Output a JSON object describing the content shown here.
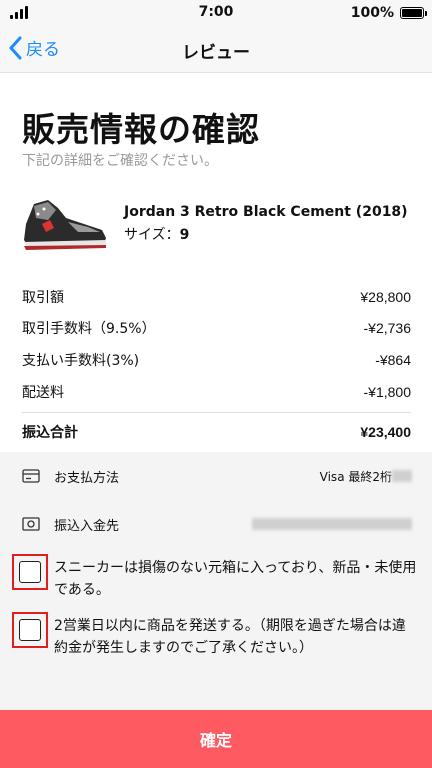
{
  "status_bar": {
    "time": "7:00",
    "battery": "100%"
  },
  "nav": {
    "back_label": "戻る",
    "title": "レビュー"
  },
  "page": {
    "title": "販売情報の確認",
    "subtitle": "下記の詳細をご確認ください。"
  },
  "product": {
    "name": "Jordan 3 Retro Black Cement (2018)",
    "size_label": "サイズ：",
    "size_value": "9"
  },
  "fees": [
    {
      "label": "取引額",
      "amount": "¥28,800"
    },
    {
      "label": "取引手数料（9.5%）",
      "amount": "-¥2,736"
    },
    {
      "label": "支払い手数料(3%)",
      "amount": "-¥864"
    },
    {
      "label": "配送料",
      "amount": "-¥1,800"
    }
  ],
  "total": {
    "label": "振込合計",
    "amount": "¥23,400"
  },
  "payment": {
    "label": "お支払方法",
    "value": "Visa 最終2桁"
  },
  "deposit": {
    "label": "振込入金先"
  },
  "checks": [
    {
      "text": "スニーカーは損傷のない元箱に入っており、新品・未使用である。"
    },
    {
      "text": "2営業日以内に商品を発送する。（期限を過ぎた場合は違約金が発生しますのでご了承ください。）"
    }
  ],
  "confirm_label": "確定",
  "colors": {
    "accent": "#fe5a62",
    "link": "#1a8cff",
    "highlight": "#e02020"
  },
  "icons": {
    "payment": "card-icon",
    "deposit": "money-icon",
    "back": "chevron-left-icon"
  }
}
